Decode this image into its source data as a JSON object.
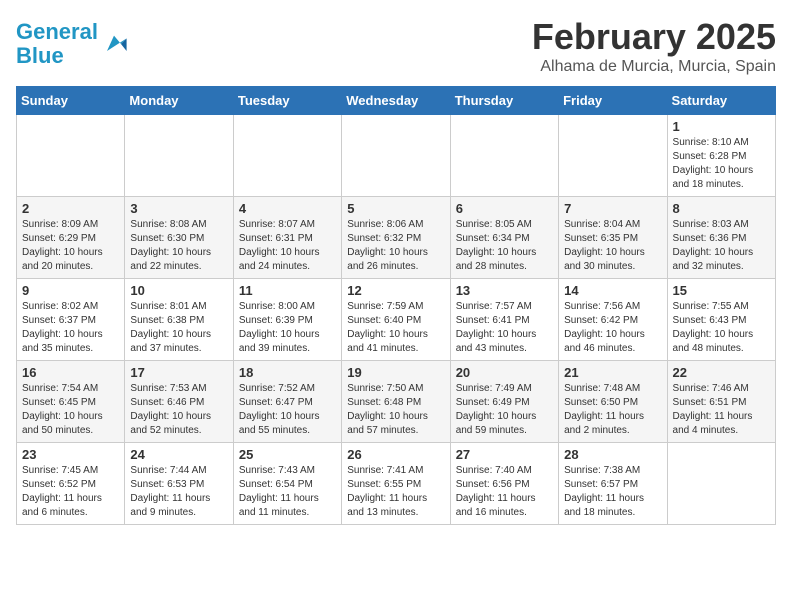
{
  "header": {
    "logo_general": "General",
    "logo_blue": "Blue",
    "month_title": "February 2025",
    "location": "Alhama de Murcia, Murcia, Spain"
  },
  "weekdays": [
    "Sunday",
    "Monday",
    "Tuesday",
    "Wednesday",
    "Thursday",
    "Friday",
    "Saturday"
  ],
  "weeks": [
    [
      {
        "day": "",
        "info": ""
      },
      {
        "day": "",
        "info": ""
      },
      {
        "day": "",
        "info": ""
      },
      {
        "day": "",
        "info": ""
      },
      {
        "day": "",
        "info": ""
      },
      {
        "day": "",
        "info": ""
      },
      {
        "day": "1",
        "info": "Sunrise: 8:10 AM\nSunset: 6:28 PM\nDaylight: 10 hours\nand 18 minutes."
      }
    ],
    [
      {
        "day": "2",
        "info": "Sunrise: 8:09 AM\nSunset: 6:29 PM\nDaylight: 10 hours\nand 20 minutes."
      },
      {
        "day": "3",
        "info": "Sunrise: 8:08 AM\nSunset: 6:30 PM\nDaylight: 10 hours\nand 22 minutes."
      },
      {
        "day": "4",
        "info": "Sunrise: 8:07 AM\nSunset: 6:31 PM\nDaylight: 10 hours\nand 24 minutes."
      },
      {
        "day": "5",
        "info": "Sunrise: 8:06 AM\nSunset: 6:32 PM\nDaylight: 10 hours\nand 26 minutes."
      },
      {
        "day": "6",
        "info": "Sunrise: 8:05 AM\nSunset: 6:34 PM\nDaylight: 10 hours\nand 28 minutes."
      },
      {
        "day": "7",
        "info": "Sunrise: 8:04 AM\nSunset: 6:35 PM\nDaylight: 10 hours\nand 30 minutes."
      },
      {
        "day": "8",
        "info": "Sunrise: 8:03 AM\nSunset: 6:36 PM\nDaylight: 10 hours\nand 32 minutes."
      }
    ],
    [
      {
        "day": "9",
        "info": "Sunrise: 8:02 AM\nSunset: 6:37 PM\nDaylight: 10 hours\nand 35 minutes."
      },
      {
        "day": "10",
        "info": "Sunrise: 8:01 AM\nSunset: 6:38 PM\nDaylight: 10 hours\nand 37 minutes."
      },
      {
        "day": "11",
        "info": "Sunrise: 8:00 AM\nSunset: 6:39 PM\nDaylight: 10 hours\nand 39 minutes."
      },
      {
        "day": "12",
        "info": "Sunrise: 7:59 AM\nSunset: 6:40 PM\nDaylight: 10 hours\nand 41 minutes."
      },
      {
        "day": "13",
        "info": "Sunrise: 7:57 AM\nSunset: 6:41 PM\nDaylight: 10 hours\nand 43 minutes."
      },
      {
        "day": "14",
        "info": "Sunrise: 7:56 AM\nSunset: 6:42 PM\nDaylight: 10 hours\nand 46 minutes."
      },
      {
        "day": "15",
        "info": "Sunrise: 7:55 AM\nSunset: 6:43 PM\nDaylight: 10 hours\nand 48 minutes."
      }
    ],
    [
      {
        "day": "16",
        "info": "Sunrise: 7:54 AM\nSunset: 6:45 PM\nDaylight: 10 hours\nand 50 minutes."
      },
      {
        "day": "17",
        "info": "Sunrise: 7:53 AM\nSunset: 6:46 PM\nDaylight: 10 hours\nand 52 minutes."
      },
      {
        "day": "18",
        "info": "Sunrise: 7:52 AM\nSunset: 6:47 PM\nDaylight: 10 hours\nand 55 minutes."
      },
      {
        "day": "19",
        "info": "Sunrise: 7:50 AM\nSunset: 6:48 PM\nDaylight: 10 hours\nand 57 minutes."
      },
      {
        "day": "20",
        "info": "Sunrise: 7:49 AM\nSunset: 6:49 PM\nDaylight: 10 hours\nand 59 minutes."
      },
      {
        "day": "21",
        "info": "Sunrise: 7:48 AM\nSunset: 6:50 PM\nDaylight: 11 hours\nand 2 minutes."
      },
      {
        "day": "22",
        "info": "Sunrise: 7:46 AM\nSunset: 6:51 PM\nDaylight: 11 hours\nand 4 minutes."
      }
    ],
    [
      {
        "day": "23",
        "info": "Sunrise: 7:45 AM\nSunset: 6:52 PM\nDaylight: 11 hours\nand 6 minutes."
      },
      {
        "day": "24",
        "info": "Sunrise: 7:44 AM\nSunset: 6:53 PM\nDaylight: 11 hours\nand 9 minutes."
      },
      {
        "day": "25",
        "info": "Sunrise: 7:43 AM\nSunset: 6:54 PM\nDaylight: 11 hours\nand 11 minutes."
      },
      {
        "day": "26",
        "info": "Sunrise: 7:41 AM\nSunset: 6:55 PM\nDaylight: 11 hours\nand 13 minutes."
      },
      {
        "day": "27",
        "info": "Sunrise: 7:40 AM\nSunset: 6:56 PM\nDaylight: 11 hours\nand 16 minutes."
      },
      {
        "day": "28",
        "info": "Sunrise: 7:38 AM\nSunset: 6:57 PM\nDaylight: 11 hours\nand 18 minutes."
      },
      {
        "day": "",
        "info": ""
      }
    ]
  ]
}
